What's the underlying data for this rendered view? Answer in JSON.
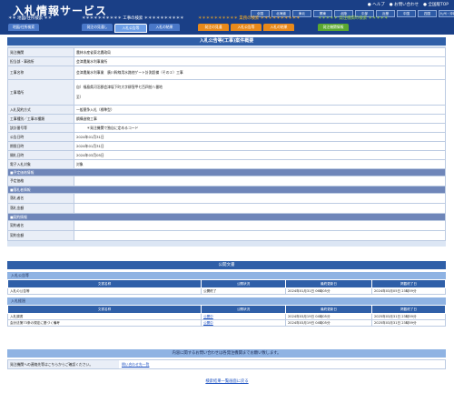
{
  "header": {
    "title": "入札情報サービス",
    "links": [
      "● ヘルプ",
      "● お問い合わせ",
      "● 全国版TOP"
    ],
    "regions_row1": [
      "全国",
      "北海道",
      "東北",
      "関東",
      "北陸",
      "中部",
      "近畿",
      "中国",
      "四国",
      "九州・沖縄"
    ],
    "regions_row2": [
      "近畿",
      "中国",
      "四国",
      "九州・沖縄"
    ]
  },
  "menu": {
    "groups": [
      {
        "title": "＊＊ 地図/住所検索 ＊＊",
        "tabs": [
          "地図/住所検索"
        ]
      },
      {
        "title": "＊＊＊＊＊＊＊＊＊＊ 工事の検索 ＊＊＊＊＊＊＊＊＊＊",
        "tabs": [
          "発注の見通し",
          "入札公告等",
          "入札の結果"
        ]
      },
      {
        "title": "＊＊＊＊＊＊＊＊＊＊ 業務の検索 ＊＊＊＊＊＊＊＊＊＊",
        "tabs": [
          "発注の見通",
          "入札公告等",
          "入札の結果"
        ]
      },
      {
        "title": "＊＊＊＊＊ 発注機関の検索 ＊＊＊＊＊",
        "tabs": [
          "発注機関情報"
        ]
      }
    ]
  },
  "form": {
    "title": "入札公告等(工事)案件概要",
    "rows": [
      {
        "label": "発注機関",
        "value": "農林水産省東北農政局",
        "type": "row"
      },
      {
        "label": "担当部・事務所",
        "value": "会津農業水利事業所",
        "type": "row"
      },
      {
        "label": "工事名称",
        "value": "会津農業水利事業　廣川幹線用水路他ゲート計測設備（その２）工事",
        "type": "row"
      },
      {
        "label": "工事場所",
        "value": "自）福島県河沼郡会津坂下町大字柳窪甲七百四拾八番地",
        "value2": "至）",
        "type": "tall"
      },
      {
        "label": "入札契約方式",
        "value": "一般競争入札（標準型）",
        "type": "row"
      },
      {
        "label": "工事種別／工事の種類",
        "value": "鋼構造物工事",
        "type": "row"
      },
      {
        "label": "該計番号等",
        "value": "　　　＊発注機関で独自に定めるコード",
        "type": "row"
      },
      {
        "label": "公告日時",
        "value": "2024年01月31日",
        "type": "row"
      },
      {
        "label": "期限日時",
        "value": "2024年01月31日",
        "type": "row"
      },
      {
        "label": "開札日時",
        "value": "2024年03月05日",
        "type": "row"
      },
      {
        "label": "電子入札対象",
        "value": "対象",
        "type": "row"
      },
      {
        "label": "■予定価格情報",
        "value": "",
        "type": "section"
      },
      {
        "label": "予定価格",
        "value": "",
        "type": "row"
      },
      {
        "label": "■落札者情報",
        "value": "",
        "type": "section"
      },
      {
        "label": "落札者名",
        "value": "",
        "type": "row"
      },
      {
        "label": "落札金額",
        "value": "",
        "type": "row"
      },
      {
        "label": "■契約情報",
        "value": "",
        "type": "section"
      },
      {
        "label": "契約者名",
        "value": "",
        "type": "row"
      },
      {
        "label": "契約金額",
        "value": "",
        "type": "row"
      }
    ]
  },
  "public_docs": {
    "title": "公開文書",
    "headers": [
      "文書名称",
      "公開状況",
      "最終更新日",
      "掲載終了日"
    ],
    "sections": [
      {
        "title": "入札公告等",
        "rows": [
          [
            "入札の公告等",
            "公開終了",
            "2024年01月31日 06時05分",
            "2024年03月05日 23時59分"
          ]
        ]
      },
      {
        "title": "入札経過",
        "rows": [
          [
            "入札調書",
            "公開中",
            "2024年03月19日 04時05分",
            "2025年03月31日 23時59分"
          ],
          [
            "会計法第73条の規定に基づく備考",
            "公開中",
            "2024年03月19日 04時05分",
            "2025年03月31日 23時59分"
          ]
        ]
      }
    ]
  },
  "contact": {
    "header": "内容に関するお問い合わせは各発注機関までお願い致します。",
    "label": "発注機関への連絡先等はこちらからご確認ください。",
    "link": "問い合わせ先一覧"
  },
  "footer": {
    "back": "検索結果一覧画面に戻る"
  }
}
